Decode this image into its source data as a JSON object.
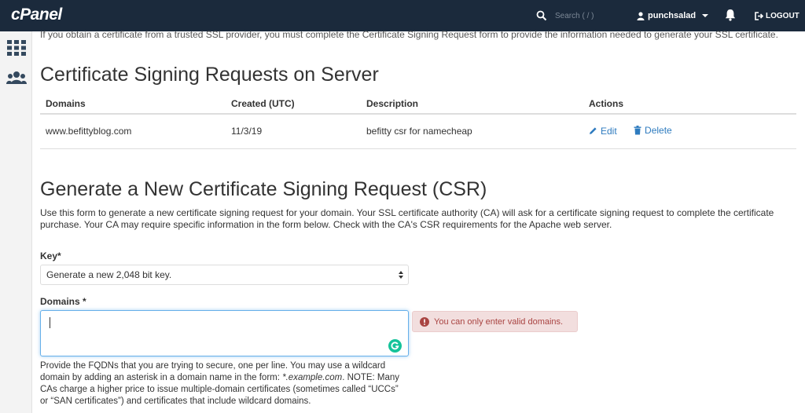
{
  "header": {
    "logo": "cPanel",
    "search_placeholder": "Search ( / )",
    "username": "punchsalad",
    "logout_label": "LOGOUT"
  },
  "page": {
    "clipped_text": "If you obtain a certificate from a trusted SSL provider, you must complete the Certificate Signing Request form to provide the information needed to generate your SSL certificate."
  },
  "csr_section": {
    "title": "Certificate Signing Requests on Server",
    "columns": [
      "Domains",
      "Created (UTC)",
      "Description",
      "Actions"
    ],
    "rows": [
      {
        "domain": "www.befittyblog.com",
        "created": "11/3/19",
        "description": "befitty csr for namecheap",
        "edit_label": "Edit",
        "delete_label": "Delete"
      }
    ]
  },
  "generate_section": {
    "title": "Generate a New Certificate Signing Request (CSR)",
    "intro": "Use this form to generate a new certificate signing request for your domain. Your SSL certificate authority (CA) will ask for a certificate signing request to complete the certificate purchase. Your CA may require specific information in the form below. Check with the CA's CSR requirements for the Apache web server.",
    "key_label": "Key*",
    "key_value": "Generate a new 2,048 bit key.",
    "domains_label": "Domains *",
    "domains_value": "",
    "error_message": "You can only enter valid domains.",
    "help_line1": "Provide the FQDNs that you are trying to secure, one per line. You may use a wildcard",
    "help_line2a": "domain by adding an asterisk in a domain name in the form: ",
    "help_example": "*.example.com",
    "help_line2b": ". NOTE: Many",
    "help_line3": "CAs charge a higher price to issue multiple-domain certificates (sometimes called “UCCs”",
    "help_line4": "or “SAN certificates”) and certificates that include wildcard domains."
  },
  "colors": {
    "topbar": "#1b2a3c",
    "link": "#2e7bbf",
    "error_bg": "#f2dede",
    "error_text": "#a94442",
    "grammarly": "#15c39a"
  },
  "icons": [
    "search-icon",
    "user-icon",
    "chevron-down-icon",
    "bell-icon",
    "logout-icon",
    "grid-icon",
    "users-icon",
    "pencil-icon",
    "trash-icon",
    "error-icon",
    "grammarly-icon"
  ]
}
